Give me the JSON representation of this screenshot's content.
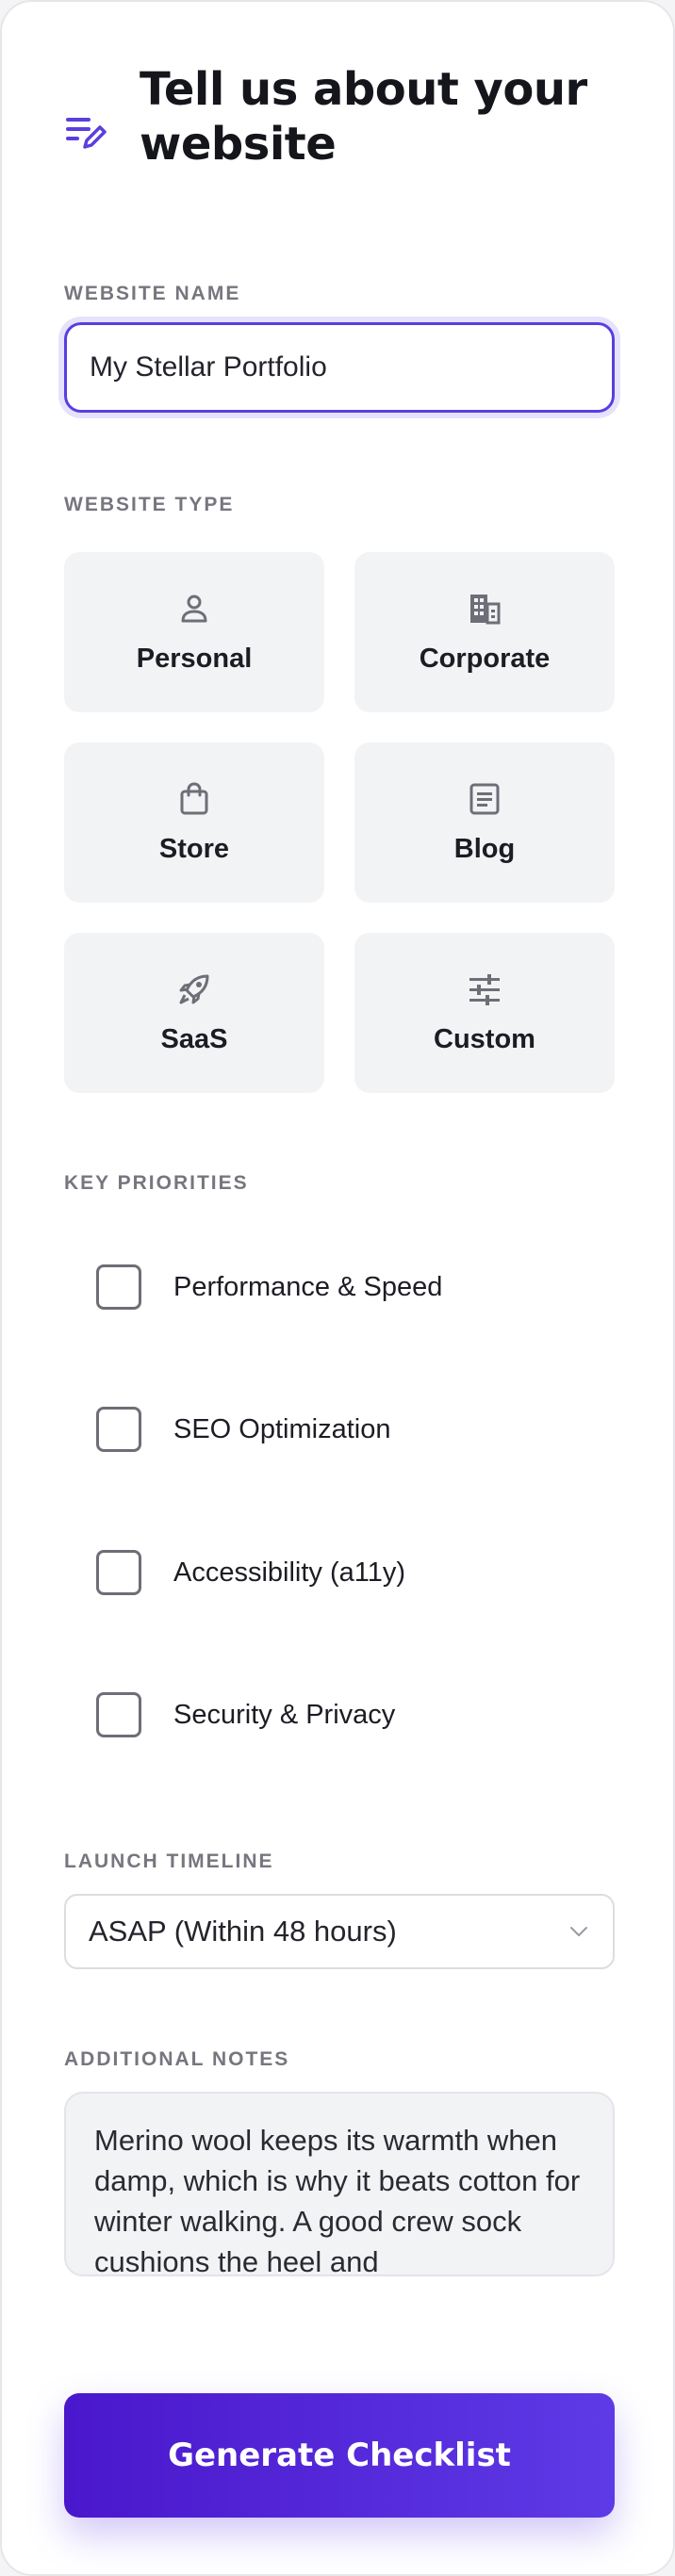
{
  "header": {
    "title": "Tell us about your website",
    "icon": "edit-list-icon"
  },
  "website_name": {
    "label": "WEBSITE NAME",
    "value": "My Stellar Portfolio"
  },
  "website_type": {
    "label": "WEBSITE TYPE",
    "options": [
      {
        "label": "Personal",
        "icon": "person-icon"
      },
      {
        "label": "Corporate",
        "icon": "building-icon"
      },
      {
        "label": "Store",
        "icon": "shopping-bag-icon"
      },
      {
        "label": "Blog",
        "icon": "article-icon"
      },
      {
        "label": "SaaS",
        "icon": "rocket-icon"
      },
      {
        "label": "Custom",
        "icon": "sliders-icon"
      }
    ]
  },
  "priorities": {
    "label": "KEY PRIORITIES",
    "items": [
      {
        "label": "Performance & Speed",
        "checked": false
      },
      {
        "label": "SEO Optimization",
        "checked": false
      },
      {
        "label": "Accessibility (a11y)",
        "checked": false
      },
      {
        "label": "Security & Privacy",
        "checked": false
      }
    ]
  },
  "timeline": {
    "label": "LAUNCH TIMELINE",
    "selected": "ASAP (Within 48 hours)"
  },
  "notes": {
    "label": "ADDITIONAL NOTES",
    "value": "Merino wool keeps its warmth when damp, which is why it beats cotton for winter walking. A good crew sock cushions the heel and"
  },
  "cta": {
    "label": "Generate Checklist"
  },
  "colors": {
    "accent": "#5b3ee0",
    "accent_dark": "#4a17cc",
    "tile_bg": "#f2f3f5",
    "label_gray": "#76767f"
  }
}
